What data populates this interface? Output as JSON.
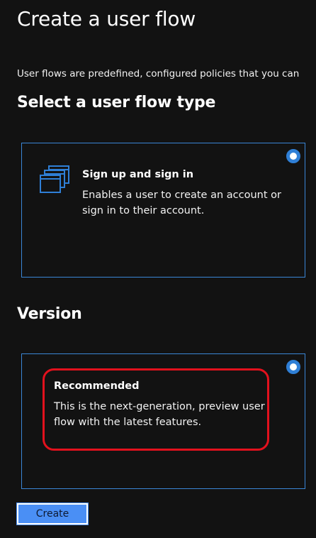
{
  "page": {
    "title": "Create a user flow",
    "intro": "User flows are predefined, configured policies that you can"
  },
  "flow_type": {
    "heading": "Select a user flow type",
    "options": [
      {
        "title": "Sign up and sign in",
        "description": "Enables a user to create an account or sign in to their account.",
        "icon": "stacked-windows-icon",
        "selected": true
      }
    ]
  },
  "version": {
    "heading": "Version",
    "options": [
      {
        "title": "Recommended",
        "description": "This is the next-generation, preview user flow with the latest features.",
        "selected": true,
        "highlighted": true
      }
    ]
  },
  "actions": {
    "create_label": "Create"
  },
  "colors": {
    "background": "#121212",
    "accent": "#2f7fd6",
    "card_border": "#3a86d6",
    "button": "#4a8ff5",
    "highlight": "#e2111d"
  }
}
